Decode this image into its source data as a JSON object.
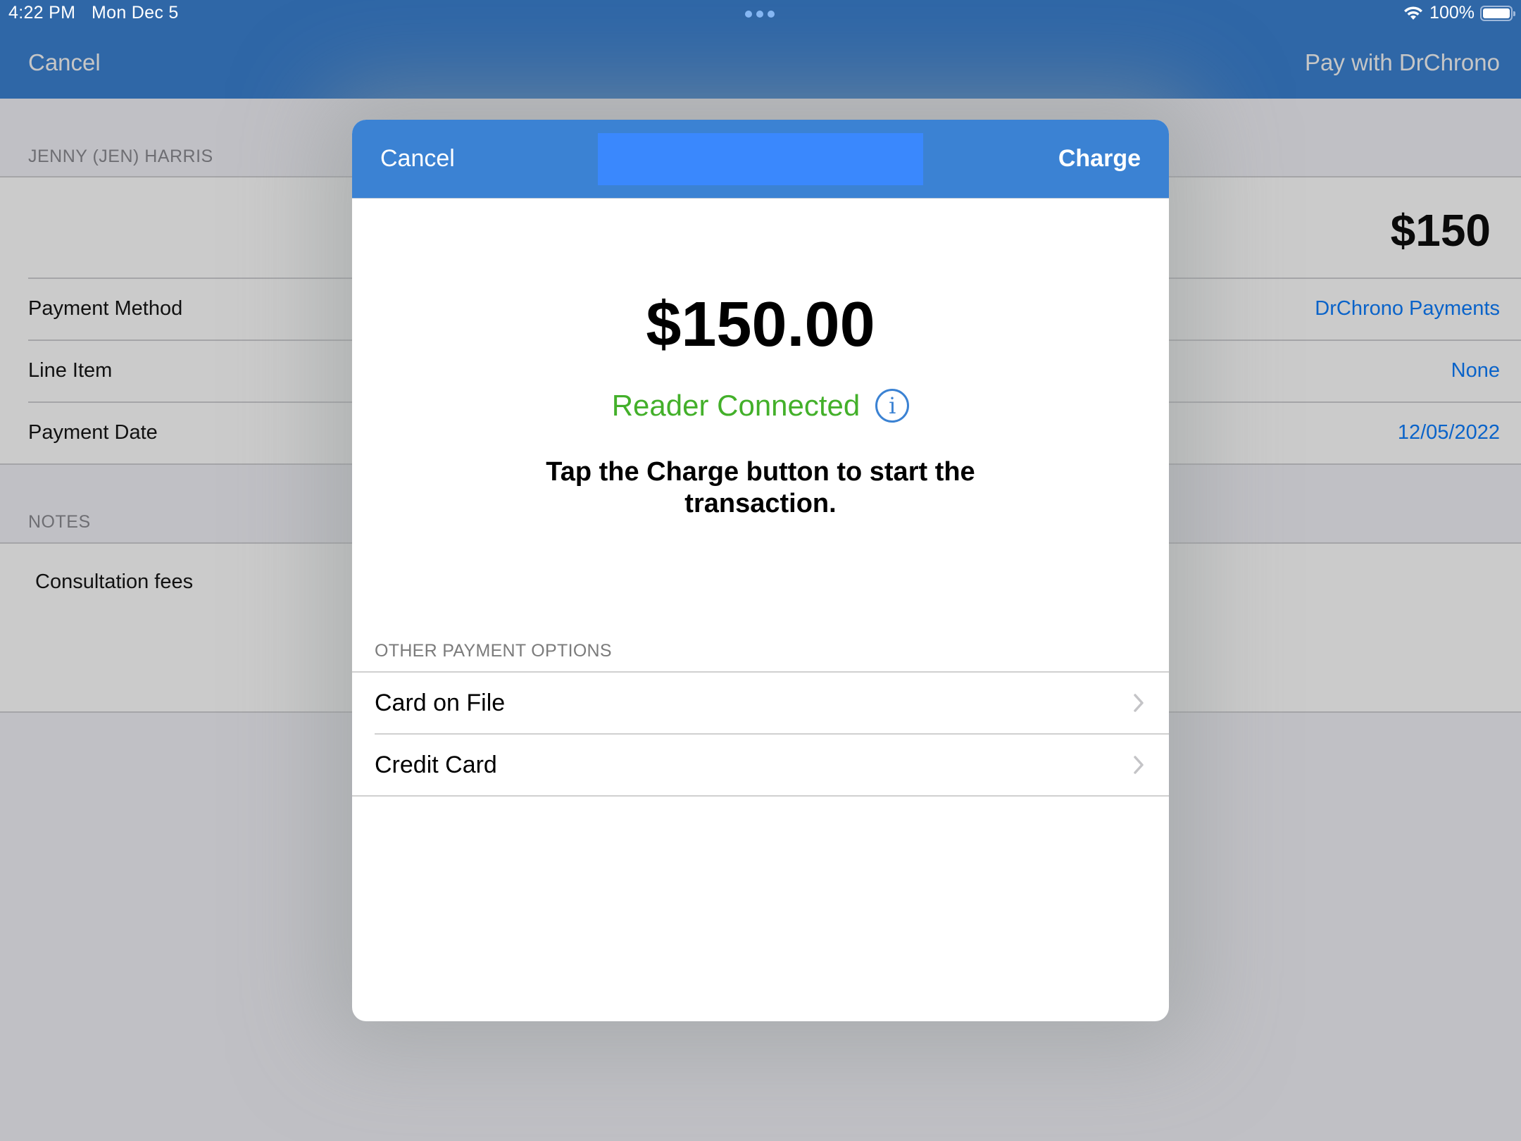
{
  "status_bar": {
    "time": "4:22 PM",
    "date": "Mon Dec 5",
    "battery": "100%",
    "wifi_icon": "wifi-icon",
    "battery_icon": "battery-icon",
    "multitask_icon": "more-dots-icon"
  },
  "nav": {
    "cancel_label": "Cancel",
    "title": "Pay with DrChrono"
  },
  "form": {
    "patient_header": "JENNY (JEN) HARRIS",
    "amount": "$150",
    "rows": [
      {
        "label": "Payment Method",
        "value": "DrChrono Payments"
      },
      {
        "label": "Line Item",
        "value": "None"
      },
      {
        "label": "Payment Date",
        "value": "12/05/2022"
      }
    ],
    "notes_header": "NOTES",
    "notes_text": "Consultation fees"
  },
  "modal": {
    "cancel_label": "Cancel",
    "charge_label": "Charge",
    "amount": "$150.00",
    "reader_status": "Reader Connected",
    "info_icon": "info-icon",
    "instruction": "Tap the Charge button to start the transaction.",
    "other_options_header": "OTHER PAYMENT OPTIONS",
    "options": [
      {
        "label": "Card on File"
      },
      {
        "label": "Credit Card"
      }
    ]
  },
  "colors": {
    "nav_bar": "#2f67a7",
    "modal_header": "#3b82d3",
    "title_redaction": "#3a88fd",
    "link_blue": "#0a63c9",
    "status_green": "#43b02a"
  }
}
